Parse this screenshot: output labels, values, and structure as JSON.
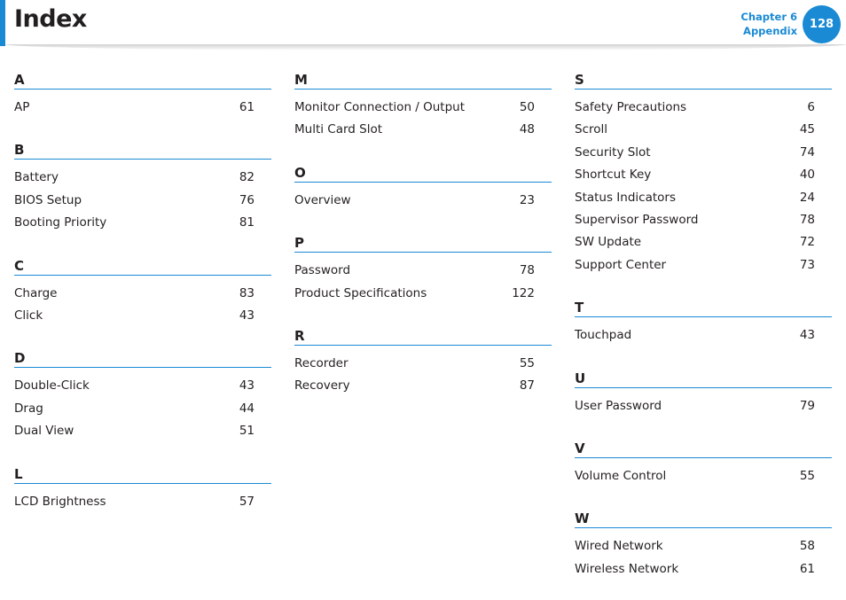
{
  "header": {
    "title": "Index",
    "chapter": "Chapter 6",
    "chapter_name": "Appendix",
    "page_number": "128",
    "accent_color": "#1a8ad4"
  },
  "columns": [
    {
      "sections": [
        {
          "letter": "A",
          "entries": [
            {
              "term": "AP",
              "page": "61"
            }
          ]
        },
        {
          "letter": "B",
          "entries": [
            {
              "term": "Battery",
              "page": "82"
            },
            {
              "term": "BIOS Setup",
              "page": "76"
            },
            {
              "term": "Booting Priority",
              "page": "81"
            }
          ]
        },
        {
          "letter": "C",
          "entries": [
            {
              "term": "Charge",
              "page": "83"
            },
            {
              "term": "Click",
              "page": "43"
            }
          ]
        },
        {
          "letter": "D",
          "entries": [
            {
              "term": "Double-Click",
              "page": "43"
            },
            {
              "term": "Drag",
              "page": "44"
            },
            {
              "term": "Dual View",
              "page": "51"
            }
          ]
        },
        {
          "letter": "L",
          "entries": [
            {
              "term": "LCD Brightness",
              "page": "57"
            }
          ]
        }
      ]
    },
    {
      "sections": [
        {
          "letter": "M",
          "entries": [
            {
              "term": "Monitor Connection / Output",
              "page": "50"
            },
            {
              "term": "Multi Card Slot",
              "page": "48"
            }
          ]
        },
        {
          "letter": "O",
          "entries": [
            {
              "term": "Overview",
              "page": "23"
            }
          ]
        },
        {
          "letter": "P",
          "entries": [
            {
              "term": "Password",
              "page": "78"
            },
            {
              "term": "Product Specifications",
              "page": "122"
            }
          ]
        },
        {
          "letter": "R",
          "entries": [
            {
              "term": "Recorder",
              "page": "55"
            },
            {
              "term": "Recovery",
              "page": "87"
            }
          ]
        }
      ]
    },
    {
      "sections": [
        {
          "letter": "S",
          "entries": [
            {
              "term": "Safety Precautions",
              "page": "6"
            },
            {
              "term": "Scroll",
              "page": "45"
            },
            {
              "term": "Security Slot",
              "page": "74"
            },
            {
              "term": "Shortcut Key",
              "page": "40"
            },
            {
              "term": "Status Indicators",
              "page": "24"
            },
            {
              "term": "Supervisor Password",
              "page": "78"
            },
            {
              "term": "SW Update",
              "page": "72"
            },
            {
              "term": "Support Center",
              "page": "73"
            }
          ]
        },
        {
          "letter": "T",
          "entries": [
            {
              "term": "Touchpad",
              "page": "43"
            }
          ]
        },
        {
          "letter": "U",
          "entries": [
            {
              "term": "User Password",
              "page": "79"
            }
          ]
        },
        {
          "letter": "V",
          "entries": [
            {
              "term": "Volume Control",
              "page": "55"
            }
          ]
        },
        {
          "letter": "W",
          "entries": [
            {
              "term": "Wired Network",
              "page": "58"
            },
            {
              "term": "Wireless Network",
              "page": "61"
            }
          ]
        }
      ]
    }
  ]
}
